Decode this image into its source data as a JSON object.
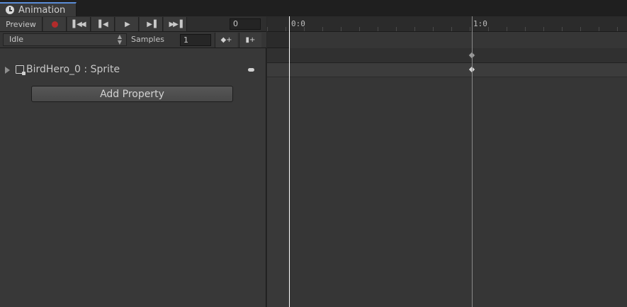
{
  "window": {
    "tab_title": "Animation",
    "tab_icon": "clock-icon"
  },
  "toolbar": {
    "preview_label": "Preview",
    "record_icon": "record-icon",
    "first_key_icon": "first-keyframe-icon",
    "prev_key_icon": "previous-keyframe-icon",
    "play_icon": "play-icon",
    "next_key_icon": "next-keyframe-icon",
    "last_key_icon": "last-keyframe-icon",
    "current_frame": "0",
    "record_color": "#b22b2b"
  },
  "clip_bar": {
    "clip_name": "Idle",
    "samples_label": "Samples",
    "samples_value": "1",
    "add_keyframe_icon": "add-keyframe-icon",
    "add_event_icon": "add-event-icon"
  },
  "properties": [
    {
      "label": "BirdHero_0 : Sprite",
      "icon": "sprite-renderer-icon"
    }
  ],
  "add_property_label": "Add Property",
  "timeline": {
    "ruler_labels": [
      "0:0",
      "1:0"
    ],
    "playhead_frame": 0,
    "keyframes_at": [
      "1:0"
    ]
  },
  "colors": {
    "tab_accent": "#5a8cd6",
    "panel_bg": "#383838",
    "timeline_bg": "#363636"
  }
}
